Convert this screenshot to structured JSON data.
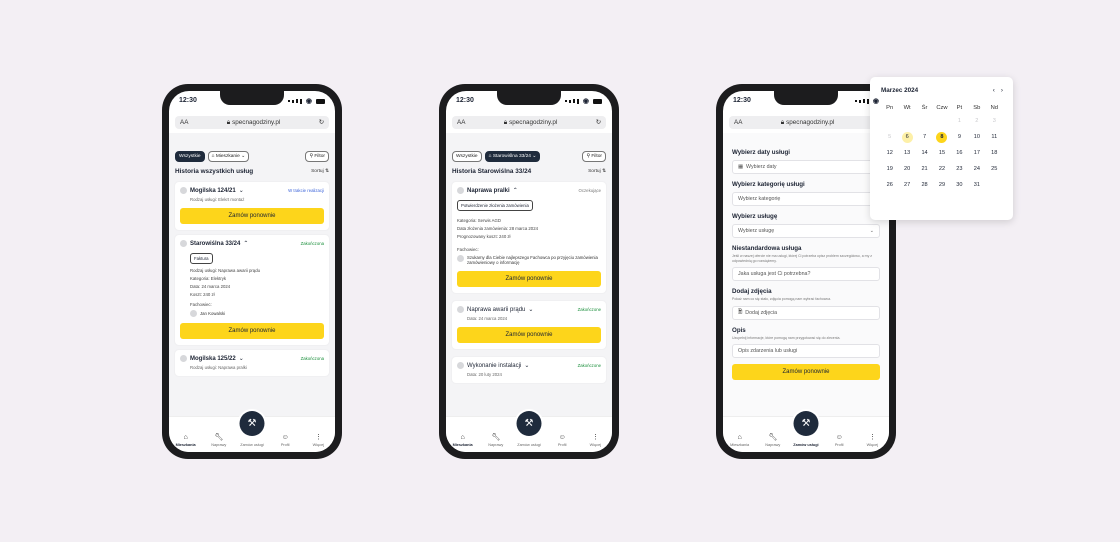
{
  "status": {
    "time": "12:30"
  },
  "browser": {
    "text_size": "AA",
    "url": "specnagodziny.pl"
  },
  "phone1": {
    "filters": {
      "all": "Wszystkie",
      "location": "Mieszkanie",
      "filter": "Filtor"
    },
    "title": "Historia wszystkich usług",
    "sort": "Sortuj",
    "cards": [
      {
        "title": "Mogilska 124/21",
        "badge": "W trakcie realizacji",
        "sub": "Rodzaj usługi: Elekrt montaż",
        "button": "Zamów ponownie"
      },
      {
        "title": "Starowiślna 33/24",
        "badge": "Zakończona",
        "tag": "Faktura",
        "lines": [
          "Rodzaj usługi: Naprawa awarii prądu",
          "Kategoria: Elektryk",
          "Data: 24 marca 2024",
          "Koszt: 240 zł"
        ],
        "worker_label": "Fachowiec:",
        "worker": "Jan Kowalski",
        "button": "Zamów ponownie"
      },
      {
        "title": "Mogilska 125/22",
        "badge": "Zakończona",
        "sub": "Rodzaj usługi: Naprawa pralki"
      }
    ]
  },
  "phone2": {
    "filters": {
      "all": "Wszystkie",
      "location": "Starowiślna 33/24",
      "filter": "Filtor"
    },
    "title": "Historia Starowiślna 33/24",
    "sort": "Sortuj",
    "cards": [
      {
        "title": "Naprawa pralki",
        "badge": "Oczekujące",
        "tag": "Potwierdzenie złożenia zamówienia",
        "lines": [
          "Kategoria: Serwis AGD",
          "Data złożenia zamówienia: 28 marca 2024",
          "Prognozowany koszt: 240 zł"
        ],
        "worker_label": "Fachowiec:",
        "worker": "Szukamy dla Ciebie najlepszego Fachowca po przyjęciu zamówienia zamówieniowy o informację",
        "button": "Zamów ponownie"
      },
      {
        "title": "Naprawa awarii prądu",
        "badge": "Zakończone",
        "sub": "Data: 24 marca 2024",
        "button": "Zamów ponownie"
      },
      {
        "title": "Wykonanie instalacji",
        "badge": "Zakończone",
        "sub": "Data: 20 luty 2024"
      }
    ]
  },
  "phone3": {
    "date_label": "Wybierz daty usługi",
    "date_placeholder": "Wybierz daty",
    "category_label": "Wybierz kategorię usługi",
    "category_placeholder": "Wybierz kategorię",
    "service_label": "Wybierz usługę",
    "service_placeholder": "Wybierz usługę",
    "custom_label": "Niestandardowa usługa",
    "custom_desc": "Jeśli w naszej ofercie nie ma usługi, której Ci potrzeba opisz problem szczegółowo, a my z odpowiednią go rozwiążemy.",
    "custom_placeholder": "Jaka usługa jest Ci potrzebna?",
    "photo_label": "Dodaj zdjęcia",
    "photo_desc": "Pokaż nam co się stało, zdjęcia pomogą nam wybrać fachowca.",
    "photo_button": "Dodaj zdjęcia",
    "desc_label": "Opis",
    "desc_desc": "Uzupełnij informacje, które pomogą nam przygotować się do zlecenia.",
    "desc_placeholder": "Opis zdarzenia lub usługi",
    "button": "Zamów ponownie"
  },
  "tabbar": {
    "home": "Mieszkania",
    "repairs": "Naprawy",
    "order": "Zamów usługi",
    "profile": "Profil",
    "more": "Więcej"
  },
  "calendar": {
    "month": "Marzec 2024",
    "prev": "‹",
    "next": "›",
    "weekdays": [
      "Pn",
      "Wt",
      "Śr",
      "Czw",
      "Pt",
      "Sb",
      "Nd"
    ],
    "days": [
      "",
      "",
      "",
      "",
      "1",
      "2",
      "3",
      "5",
      "6",
      "7",
      "8",
      "9",
      "10",
      "11",
      "12",
      "13",
      "14",
      "15",
      "16",
      "17",
      "18",
      "19",
      "20",
      "21",
      "22",
      "23",
      "24",
      "25",
      "26",
      "27",
      "28",
      "29",
      "30",
      "31",
      ""
    ],
    "today": "6",
    "selected": "8"
  }
}
